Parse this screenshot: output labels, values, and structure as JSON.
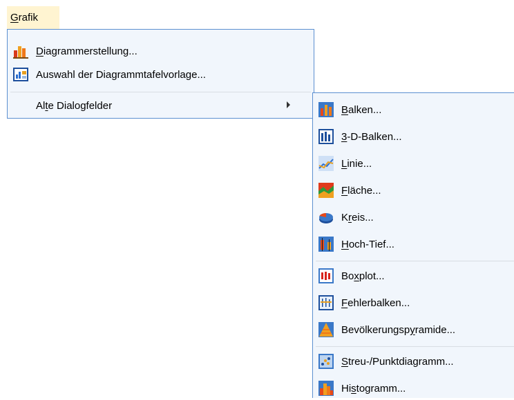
{
  "menubar": {
    "grafik": {
      "pre": "",
      "key": "G",
      "post": "rafik"
    }
  },
  "main_menu": {
    "items": [
      {
        "pre": "",
        "key": "D",
        "post": "iagrammerstellung...",
        "icon": "chart-builder-icon"
      },
      {
        "pre": "Auswahl der Dia",
        "key": "g",
        "post": "rammtafelvorlage...",
        "icon": "template-chooser-icon"
      },
      {
        "pre": "Al",
        "key": "t",
        "post": "e Dialogfelder",
        "icon": ""
      }
    ]
  },
  "sub_menu": {
    "items": [
      {
        "pre": "",
        "key": "B",
        "post": "alken...",
        "icon": "bar-chart-icon"
      },
      {
        "pre": "",
        "key": "3",
        "post": "-D-Balken...",
        "icon": "3d-bar-chart-icon"
      },
      {
        "pre": "",
        "key": "L",
        "post": "inie...",
        "icon": "line-chart-icon"
      },
      {
        "pre": "",
        "key": "F",
        "post": "läche...",
        "icon": "area-chart-icon"
      },
      {
        "pre": "K",
        "key": "r",
        "post": "eis...",
        "icon": "pie-chart-icon"
      },
      {
        "pre": "",
        "key": "H",
        "post": "och-Tief...",
        "icon": "high-low-chart-icon"
      },
      {
        "pre": "Bo",
        "key": "x",
        "post": "plot...",
        "icon": "boxplot-icon"
      },
      {
        "pre": "",
        "key": "F",
        "post": "ehlerbalken...",
        "icon": "error-bar-icon"
      },
      {
        "pre": "Bevölkerungsp",
        "key": "y",
        "post": "ramide...",
        "icon": "population-pyramid-icon"
      },
      {
        "pre": "",
        "key": "S",
        "post": "treu-/Punktdiagramm...",
        "icon": "scatter-plot-icon"
      },
      {
        "pre": "Hi",
        "key": "s",
        "post": "togramm...",
        "icon": "histogram-icon"
      }
    ]
  }
}
